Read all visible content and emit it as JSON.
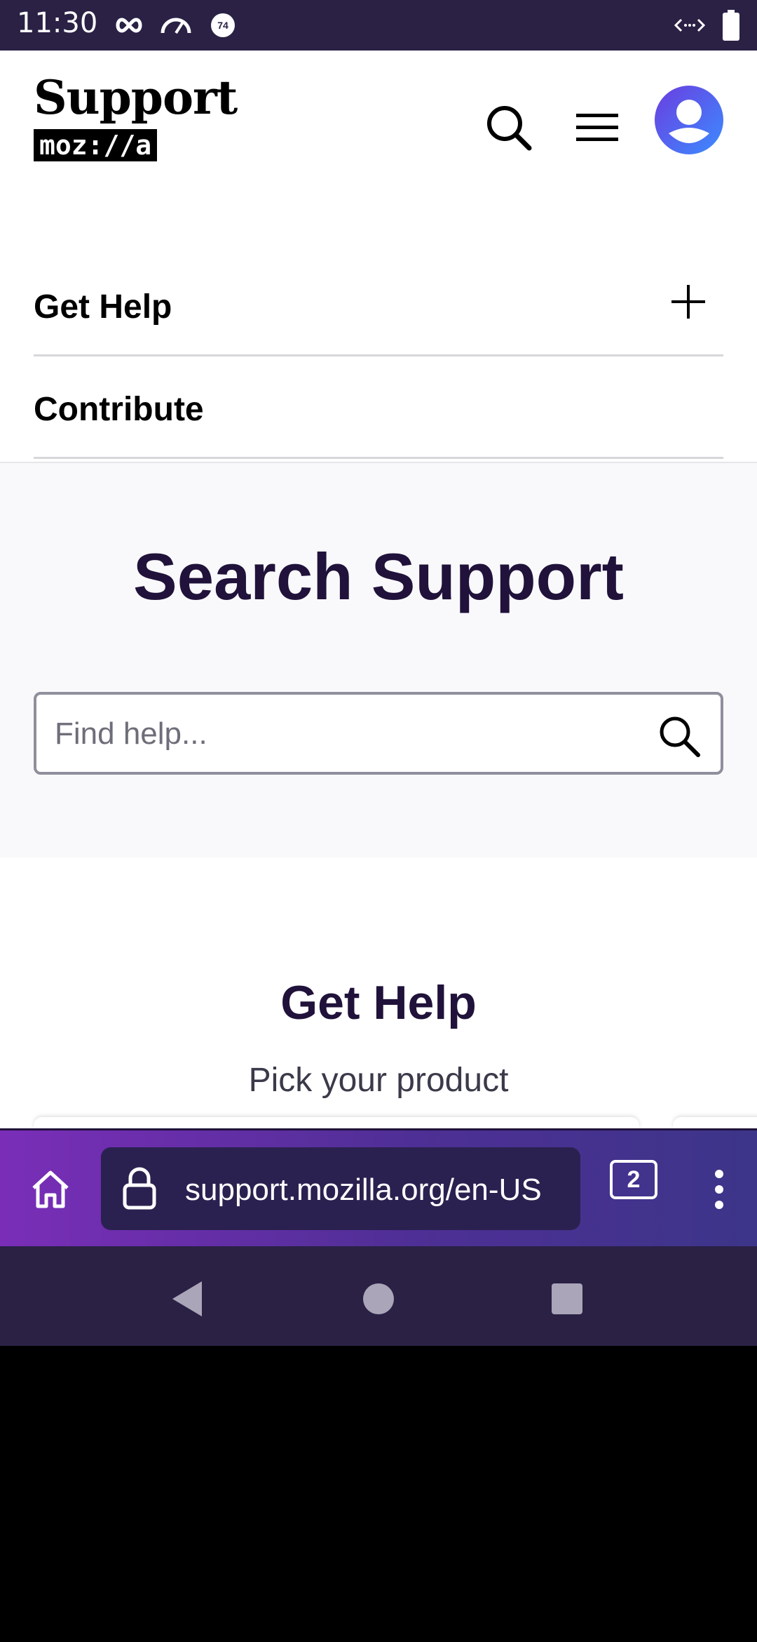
{
  "status_bar": {
    "time": "11:30",
    "icons": [
      "infinity-icon",
      "speedometer-icon",
      "notification-74-icon",
      "code-icon",
      "battery-icon"
    ],
    "badge_number": "74"
  },
  "header": {
    "logo_text": "Support",
    "logo_badge": "moz://a",
    "icons": [
      "search-icon",
      "menu-icon",
      "avatar-icon"
    ]
  },
  "nav": {
    "items": [
      {
        "label": "Get Help",
        "expand_icon": "plus-icon"
      },
      {
        "label": "Contribute"
      }
    ]
  },
  "search": {
    "title": "Search Support",
    "placeholder": "Find help...",
    "submit_icon": "search-icon"
  },
  "get_help": {
    "title": "Get Help",
    "subtitle": "Pick your product"
  },
  "browser_toolbar": {
    "url": "support.mozilla.org/en-US",
    "tab_count": "2",
    "icons": [
      "home-icon",
      "lock-icon",
      "tabs-icon",
      "more-icon"
    ]
  },
  "system_nav": {
    "icons": [
      "back-icon",
      "home-circle-icon",
      "recents-icon"
    ]
  },
  "colors": {
    "heading": "#20123a",
    "status_bar": "#2a2145",
    "toolbar_start": "#7a2eb8",
    "toolbar_end": "#3c3589",
    "url_bar": "#2b2150"
  }
}
